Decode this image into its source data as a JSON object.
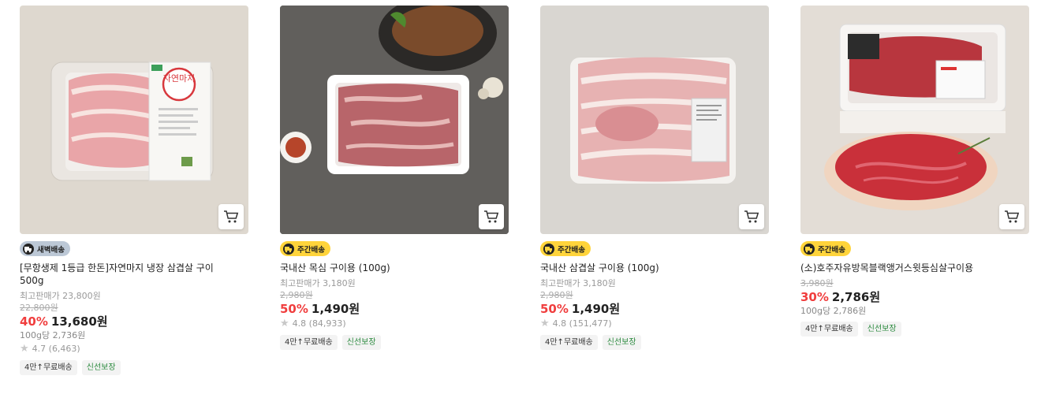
{
  "products": [
    {
      "shipping": "새벽배송",
      "name": "[무항생제 1등급 한돈]자연마지 냉장 삼겹살 구이 500g",
      "max_price_label": "최고판매가 23,800원",
      "original_price": "22,800원",
      "discount": "40%",
      "price": "13,680원",
      "unit_price": "100g당 2,736원",
      "rating": "4.7 (6,463)",
      "tags": [
        "4만↑무료배송",
        "신선보장"
      ],
      "package_label": "자연마지"
    },
    {
      "shipping": "주간배송",
      "name": "국내산 목심 구이용 (100g)",
      "max_price_label": "최고판매가 3,180원",
      "original_price": "2,980원",
      "discount": "50%",
      "price": "1,490원",
      "rating": "4.8 (84,933)",
      "tags": [
        "4만↑무료배송",
        "신선보장"
      ]
    },
    {
      "shipping": "주간배송",
      "name": "국내산 삼겹살 구이용 (100g)",
      "max_price_label": "최고판매가 3,180원",
      "original_price": "2,980원",
      "discount": "50%",
      "price": "1,490원",
      "rating": "4.8 (151,477)",
      "tags": [
        "4만↑무료배송",
        "신선보장"
      ]
    },
    {
      "shipping": "주간배송",
      "name": "(소)호주자유방목블랙앵거스윗등심살구이용",
      "original_price": "3,980원",
      "discount": "30%",
      "price": "2,786원",
      "unit_price": "100g당 2,786원",
      "tags": [
        "4만↑무료배송",
        "신선보장"
      ]
    }
  ],
  "icons": {
    "cart": "cart-icon",
    "truck": "truck-icon",
    "star": "star-icon"
  },
  "colors": {
    "discount": "#f03e3e",
    "fresh_tag": "#2b8a3e",
    "weekly_badge": "#ffd43b",
    "dawn_badge": "#bcc8d6"
  }
}
